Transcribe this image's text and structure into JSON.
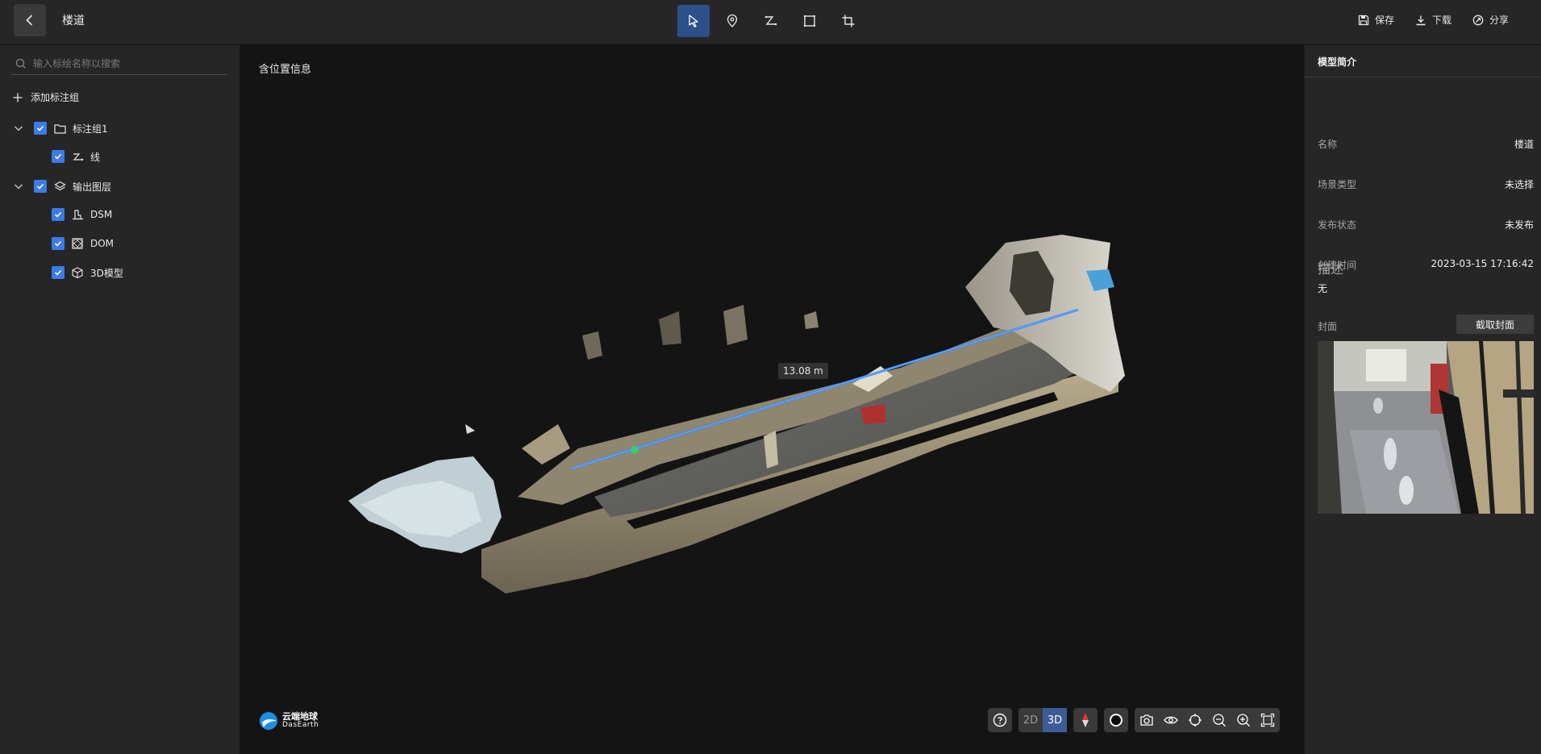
{
  "header": {
    "title": "楼道",
    "actions": {
      "save": "保存",
      "download": "下载",
      "share": "分享"
    }
  },
  "sidebar": {
    "search_placeholder": "输入标绘名称以搜索",
    "add_group": "添加标注组",
    "tree": {
      "group1": {
        "label": "标注组1",
        "children": [
          "线"
        ]
      },
      "output": {
        "label": "输出图层",
        "children": [
          "DSM",
          "DOM",
          "3D模型"
        ]
      }
    }
  },
  "viewport": {
    "label": "含位置信息",
    "measurement": "13.08 m",
    "brand": {
      "cn": "云端地球",
      "en": "DasEarth"
    },
    "view_mode": {
      "options": [
        "2D",
        "3D"
      ],
      "selected": "3D"
    }
  },
  "info": {
    "title": "模型简介",
    "rows": [
      {
        "key": "名称",
        "value": "楼道"
      },
      {
        "key": "场景类型",
        "value": "未选择"
      },
      {
        "key": "发布状态",
        "value": "未发布"
      },
      {
        "key": "创建时间",
        "value": "2023-03-15 17:16:42"
      }
    ],
    "desc_key": "描述",
    "desc_value": "无",
    "cover_key": "封面",
    "cover_button": "截取封面"
  },
  "colors": {
    "accent": "#3c7be8",
    "active_tool": "#2d4f8a",
    "measure_line": "#3a8cff"
  }
}
